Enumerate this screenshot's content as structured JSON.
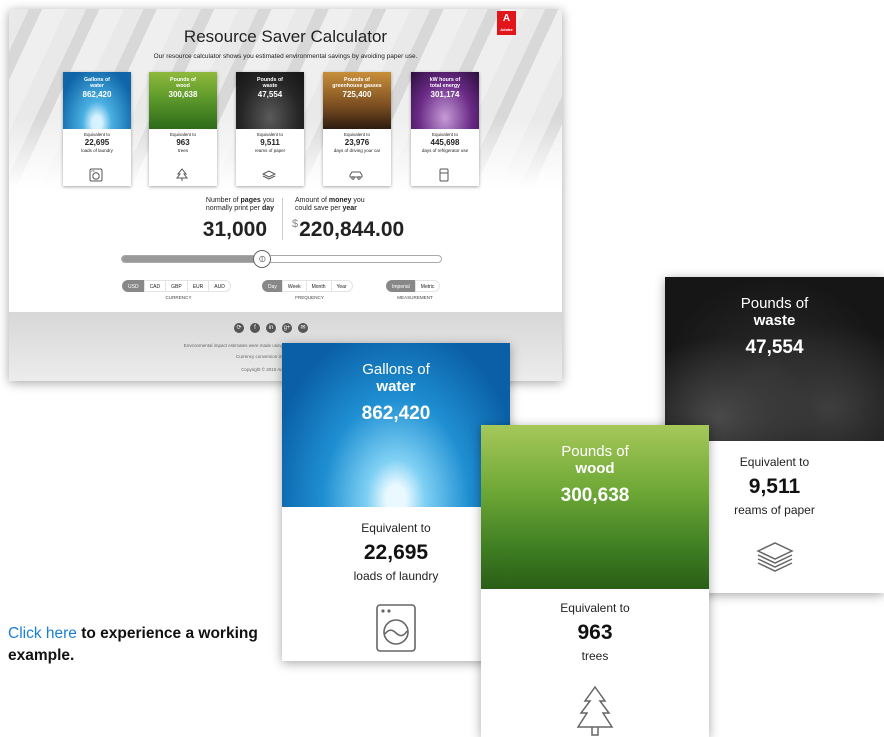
{
  "calculator": {
    "logo_text": "Adobe",
    "title": "Resource Saver Calculator",
    "subtitle": "Our resource calculator shows you estimated environmental savings by avoiding paper use.",
    "cards": [
      {
        "l1": "Gallons of",
        "l2": "water",
        "value": "862,420",
        "equivalent": "Equivalent to",
        "eq_value": "22,695",
        "eq_unit": "loads of laundry",
        "icon": "washing-machine-icon"
      },
      {
        "l1": "Pounds of",
        "l2": "wood",
        "value": "300,638",
        "equivalent": "Equivalent to",
        "eq_value": "963",
        "eq_unit": "trees",
        "icon": "tree-icon"
      },
      {
        "l1": "Pounds of",
        "l2": "waste",
        "value": "47,554",
        "equivalent": "Equivalent to",
        "eq_value": "9,511",
        "eq_unit": "reams of paper",
        "icon": "paper-stack-icon"
      },
      {
        "l1": "Pounds of",
        "l2": "greenhouse gasses",
        "value": "725,400",
        "equivalent": "Equivalent to",
        "eq_value": "23,976",
        "eq_unit": "days of driving your car",
        "icon": "car-icon"
      },
      {
        "l1": "kW hours of",
        "l2": "total energy",
        "value": "301,174",
        "equivalent": "Equivalent to",
        "eq_value": "445,698",
        "eq_unit": "days of refrigerator use",
        "icon": "refrigerator-icon"
      }
    ],
    "pages": {
      "label_a": "Number of ",
      "label_b": "pages",
      "label_c": " you",
      "label_d": "normally print per ",
      "label_e": "day",
      "value": "31,000"
    },
    "money": {
      "label_a": "Amount of ",
      "label_b": "money",
      "label_c": " you",
      "label_d": "could save per ",
      "label_e": "year",
      "currency_symbol": "$",
      "value": "220,844.00"
    },
    "slider": {
      "fraction": 0.44,
      "thumb_glyph": "⦶"
    },
    "currency": {
      "options": [
        "USD",
        "CAD",
        "GBP",
        "EUR",
        "AUD"
      ],
      "selected": "USD",
      "caption": "CURRENCY"
    },
    "frequency": {
      "options": [
        "Day",
        "Week",
        "Month",
        "Year"
      ],
      "selected": "Day",
      "caption": "FREQUENCY"
    },
    "measurement": {
      "options": [
        "Imperial",
        "Metric"
      ],
      "selected": "Imperial",
      "caption": "MEASUREMENT"
    },
    "footer": {
      "social_icons": [
        "share-icon",
        "facebook-icon",
        "linkedin-icon",
        "google-plus-icon",
        "email-icon"
      ],
      "note1": "Environmental impact estimates were made using the Environmental Paper Network Paper Calculator.",
      "note2": "Currency conversion is based on the latest 5-year",
      "note3": "Copyright © 2019 Adobe. All rights reserved."
    }
  },
  "big_cards": {
    "water": {
      "l1": "Gallons of",
      "l2": "water",
      "value": "862,420",
      "equivalent": "Equivalent to",
      "eq_value": "22,695",
      "eq_unit": "loads of laundry"
    },
    "wood": {
      "l1": "Pounds of",
      "l2": "wood",
      "value": "300,638",
      "equivalent": "Equivalent to",
      "eq_value": "963",
      "eq_unit": "trees"
    },
    "waste": {
      "l1": "Pounds of",
      "l2": "waste",
      "value": "47,554",
      "equivalent": "Equivalent to",
      "eq_value": "9,511",
      "eq_unit": "reams of paper"
    }
  },
  "cta": {
    "link_text": "Click here",
    "rest_text": " to experience a working example."
  },
  "colors": {
    "accent_link": "#1a7fd8",
    "adobe_red": "#e2151b",
    "selected_pill": "#888888"
  }
}
